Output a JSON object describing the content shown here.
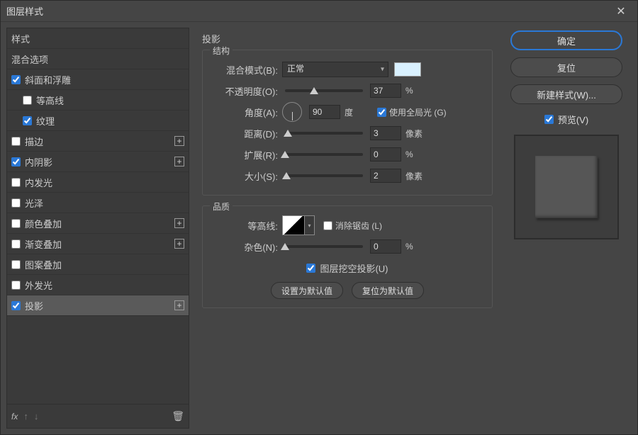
{
  "title": "图层样式",
  "sidebar": {
    "style_header": "样式",
    "blend_header": "混合选项",
    "items": [
      {
        "label": "斜面和浮雕",
        "checked": true,
        "interact": true,
        "plus": false
      },
      {
        "label": "等高线",
        "checked": false,
        "interact": true,
        "plus": false,
        "indent": true
      },
      {
        "label": "纹理",
        "checked": true,
        "interact": true,
        "plus": false,
        "indent": true
      },
      {
        "label": "描边",
        "checked": false,
        "interact": true,
        "plus": true
      },
      {
        "label": "内阴影",
        "checked": true,
        "interact": true,
        "plus": true
      },
      {
        "label": "内发光",
        "checked": false,
        "interact": true,
        "plus": false
      },
      {
        "label": "光泽",
        "checked": false,
        "interact": true,
        "plus": false
      },
      {
        "label": "颜色叠加",
        "checked": false,
        "interact": true,
        "plus": true
      },
      {
        "label": "渐变叠加",
        "checked": false,
        "interact": true,
        "plus": true
      },
      {
        "label": "图案叠加",
        "checked": false,
        "interact": true,
        "plus": false
      },
      {
        "label": "外发光",
        "checked": false,
        "interact": true,
        "plus": false
      },
      {
        "label": "投影",
        "checked": true,
        "interact": true,
        "plus": true,
        "selected": true
      }
    ],
    "fx_label": "fx"
  },
  "panel": {
    "title": "投影",
    "structure_legend": "结构",
    "blend_mode_label": "混合模式(B):",
    "blend_mode_value": "正常",
    "opacity_label": "不透明度(O):",
    "opacity_value": "37",
    "opacity_unit": "%",
    "angle_label": "角度(A):",
    "angle_value": "90",
    "angle_unit": "度",
    "global_light_label": "使用全局光 (G)",
    "global_light_checked": true,
    "distance_label": "距离(D):",
    "distance_value": "3",
    "distance_unit": "像素",
    "spread_label": "扩展(R):",
    "spread_value": "0",
    "spread_unit": "%",
    "size_label": "大小(S):",
    "size_value": "2",
    "size_unit": "像素",
    "quality_legend": "品质",
    "contour_label": "等高线:",
    "antialias_label": "消除锯齿 (L)",
    "antialias_checked": false,
    "noise_label": "杂色(N):",
    "noise_value": "0",
    "noise_unit": "%",
    "knockout_label": "图层挖空投影(U)",
    "knockout_checked": true,
    "set_default": "设置为默认值",
    "reset_default": "复位为默认值"
  },
  "right": {
    "ok": "确定",
    "reset": "复位",
    "new_style": "新建样式(W)...",
    "preview_label": "预览(V)",
    "preview_checked": true
  },
  "colors": {
    "accent": "#2a78d6",
    "swatch": "#d9f1ff"
  }
}
